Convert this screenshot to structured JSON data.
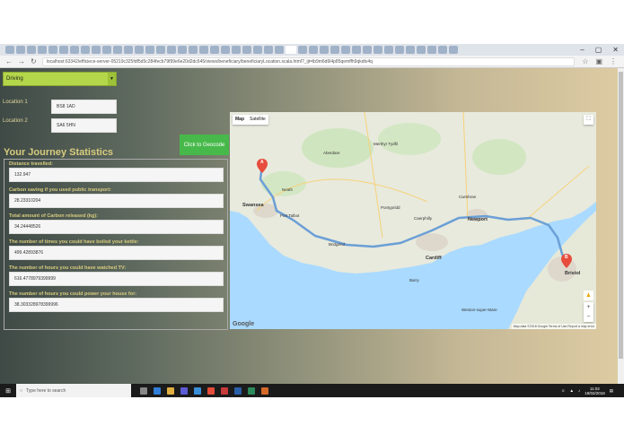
{
  "browser": {
    "url": "localhost:63342/efficiece-server-05219c325fdf5d5c284fecb79f99e6e20d2dc645/views/beneficiary/beneficiaryLocation.scala.html?_ijt=lb9m6d6l4p85qemffh9qkdtv4q",
    "window_controls": [
      "–",
      "▢",
      "✕"
    ]
  },
  "form": {
    "travel_mode": "Driving",
    "location1_label": "Location 1",
    "location1_value": "BS8 1AD",
    "location2_label": "Location 2",
    "location2_value": "SA6 5HN",
    "geocode_button": "Click to Geocode"
  },
  "stats": {
    "heading": "Your Journey Statistics",
    "items": [
      {
        "label": "Distance travelled:",
        "value": "132.947"
      },
      {
        "label": "Carbon saving if you used public transport:",
        "value": "28.23310204"
      },
      {
        "label": "Total amount of Carbon released (kg):",
        "value": "34.24448526"
      },
      {
        "label": "The number of times you could have boiled your kettle:",
        "value": "499.42893876"
      },
      {
        "label": "The number of hours you could have watched TV:",
        "value": "616.4778979399999"
      },
      {
        "label": "The number of hours you could power your house for:",
        "value": "38.303328978399996"
      }
    ]
  },
  "map": {
    "type_buttons": [
      "Map",
      "Satellite"
    ],
    "selected_type": "Map",
    "marker_a": "A",
    "marker_b": "B",
    "labels": {
      "neath": "Neath",
      "swansea": "Swansea",
      "port_talbot": "Port Talbot",
      "cardiff": "Cardiff",
      "newport": "Newport",
      "cwmbran": "Cwmbran",
      "bristol": "Bristol",
      "aberdare": "Aberdare",
      "merthyr": "Merthyr Tydfil",
      "bridgend": "Bridgend",
      "barry": "Barry",
      "weston": "Weston-super-Mare",
      "caerphilly": "Caerphilly",
      "pontypridd": "Pontypridd"
    },
    "google_logo": "Google",
    "credits": "Map data ©2018 Google   Terms of Use   Report a map error",
    "zoom_in": "+",
    "zoom_out": "−",
    "route_color": "#6b9fd6",
    "water_color": "#aadaff",
    "land_color": "#e8eadd"
  },
  "taskbar": {
    "search_placeholder": "Type here to search",
    "time": "11:02",
    "date": "18/02/2018"
  }
}
